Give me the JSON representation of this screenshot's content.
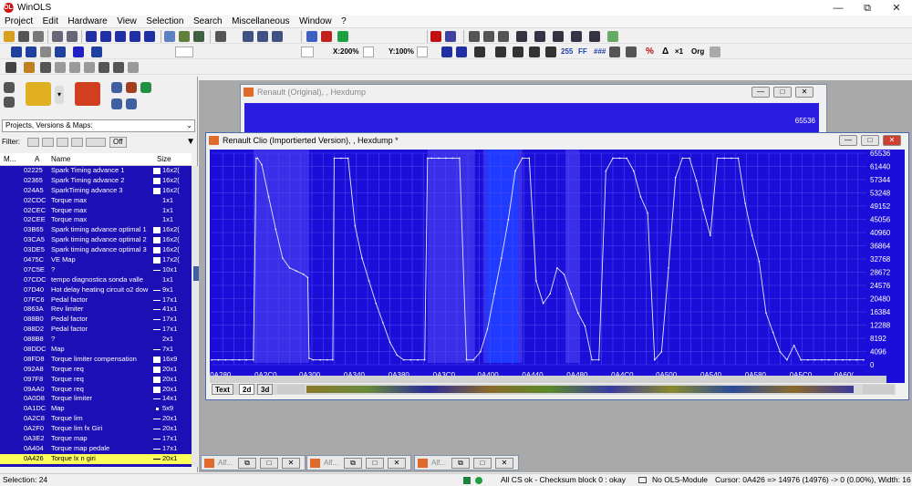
{
  "app": {
    "title": "WinOLS",
    "logo": "OLS",
    "min": "—",
    "max": "⧉",
    "close": "✕"
  },
  "menu": [
    "Project",
    "Edit",
    "Hardware",
    "View",
    "Selection",
    "Search",
    "Miscellaneous",
    "Window",
    "?"
  ],
  "toolbar2": {
    "zoomx": "X:200%",
    "zoomy": "Y:100%",
    "btn_hex": "255",
    "btn_ff": "FF",
    "btn_dec": "###",
    "btn_pct": "%",
    "btn_delta": "Δ",
    "btn_x1": "×1",
    "btn_org": "Org"
  },
  "sidebar": {
    "dropdown_value": "Projects, Versions & Maps:",
    "filter_label": "Filter:",
    "filter_off": "Off",
    "head_m": "M...",
    "head_addr": "A",
    "head_name": "Name",
    "head_size": "Size",
    "rows": [
      {
        "addr": "02225",
        "name": "Spark Timing advance 1",
        "size": "16x2(",
        "marker": "box"
      },
      {
        "addr": "02365",
        "name": "Spark Timing advance  2",
        "size": "16x2(",
        "marker": "box"
      },
      {
        "addr": "024A5",
        "name": "SparkTiming advance 3",
        "size": "16x2(",
        "marker": "box"
      },
      {
        "addr": "02CDC",
        "name": "Torque max",
        "size": "1x1",
        "marker": "none"
      },
      {
        "addr": "02CEC",
        "name": "Torque max",
        "size": "1x1",
        "marker": "none"
      },
      {
        "addr": "02CEE",
        "name": "Torque max",
        "size": "1x1",
        "marker": "none"
      },
      {
        "addr": "03B65",
        "name": "Spark timing advance optimal 1",
        "size": "16x2(",
        "marker": "box"
      },
      {
        "addr": "03CA5",
        "name": "Spark timing advance optimal 2",
        "size": "16x2(",
        "marker": "box"
      },
      {
        "addr": "03DE5",
        "name": "Spark timing advance optimal 3",
        "size": "16x2(",
        "marker": "box"
      },
      {
        "addr": "0475C",
        "name": "VE Map",
        "size": "17x2(",
        "marker": "box"
      },
      {
        "addr": "07C5E",
        "name": "?",
        "size": "10x1",
        "marker": "line"
      },
      {
        "addr": "07CDC",
        "name": "tempo diagnostica sonda valle",
        "size": "1x1",
        "marker": "none"
      },
      {
        "addr": "07D40",
        "name": "Hot delay heating circuit o2 dow",
        "size": "9x1",
        "marker": "line"
      },
      {
        "addr": "07FC6",
        "name": "Pedal factor",
        "size": "17x1",
        "marker": "line"
      },
      {
        "addr": "0863A",
        "name": "Rev limiter",
        "size": "41x1",
        "marker": "line"
      },
      {
        "addr": "088B0",
        "name": "Pedal factor",
        "size": "17x1",
        "marker": "line"
      },
      {
        "addr": "088D2",
        "name": "Pedal factor",
        "size": "17x1",
        "marker": "line"
      },
      {
        "addr": "088B8",
        "name": "?",
        "size": "2x1",
        "marker": "none"
      },
      {
        "addr": "08DDC",
        "name": "Map",
        "size": "7x1",
        "marker": "line"
      },
      {
        "addr": "08FD8",
        "name": "Torque limiter compensation",
        "size": "16x9",
        "marker": "box"
      },
      {
        "addr": "092A8",
        "name": "Torque req",
        "size": "20x1",
        "marker": "box"
      },
      {
        "addr": "097F8",
        "name": "Torque req",
        "size": "20x1",
        "marker": "box"
      },
      {
        "addr": "09AA0",
        "name": "Torque req",
        "size": "20x1",
        "marker": "box"
      },
      {
        "addr": "0A0D8",
        "name": "Torque limiter",
        "size": "14x1",
        "marker": "line"
      },
      {
        "addr": "0A1DC",
        "name": "Map",
        "size": "5x9",
        "marker": "dot"
      },
      {
        "addr": "0A2C8",
        "name": "Torque lim",
        "size": "20x1",
        "marker": "line"
      },
      {
        "addr": "0A2F0",
        "name": "Torque lim fx Giri",
        "size": "20x1",
        "marker": "line"
      },
      {
        "addr": "0A3E2",
        "name": "Torque map",
        "size": "17x1",
        "marker": "line"
      },
      {
        "addr": "0A404",
        "name": "Torque map pedale",
        "size": "17x1",
        "marker": "line"
      },
      {
        "addr": "0A426",
        "name": "Torque lx n giri",
        "size": "20x1",
        "marker": "line",
        "selected": true
      }
    ]
  },
  "back_window": {
    "title": "Renault (Original), , Hexdump",
    "value": "65536"
  },
  "front_window": {
    "title": "Renault Clio (Importierted Version), , Hexdump *",
    "tab_text": "Text",
    "tab_2d": "2d",
    "tab_3d": "3d",
    "y_ticks": [
      "65536",
      "61440",
      "57344",
      "53248",
      "49152",
      "45056",
      "40960",
      "36864",
      "32768",
      "28672",
      "24576",
      "20480",
      "16384",
      "12288",
      "8192",
      "4096",
      "0"
    ],
    "x_ticks": [
      "0A280",
      "0A2C0",
      "0A300",
      "0A340",
      "0A380",
      "0A3C0",
      "0A400",
      "0A440",
      "0A480",
      "0A4C0",
      "0A500",
      "0A540",
      "0A580",
      "0A5C0",
      "0A60("
    ]
  },
  "chart_data": {
    "type": "line",
    "xlabel": "",
    "ylabel": "",
    "ylim": [
      0,
      65536
    ],
    "x_range": [
      "0A270",
      "0A61C"
    ],
    "series": [
      {
        "x": [
          "0A270",
          "0A27A",
          "0A284",
          "0A28E",
          "0A298",
          "0A2A2",
          "0A2AC",
          "0A2B0",
          "0A2B2",
          "0A2B8",
          "0A2C2",
          "0A2CC",
          "0A2D6",
          "0A2E0",
          "0A2EA",
          "0A2F4",
          "0A2FA",
          "0A2FC",
          "0A302",
          "0A30C",
          "0A316",
          "0A31E",
          "0A320",
          "0A32A",
          "0A334",
          "0A33E",
          "0A348",
          "0A352",
          "0A35C",
          "0A366",
          "0A370",
          "0A37A",
          "0A384",
          "0A38E",
          "0A398",
          "0A3A2",
          "0A3A6",
          "0A3AC",
          "0A3B6",
          "0A3C0",
          "0A3CA",
          "0A3D4",
          "0A3DE",
          "0A3E8",
          "0A3F2",
          "0A3FC",
          "0A406",
          "0A410",
          "0A41A",
          "0A424",
          "0A42E",
          "0A438",
          "0A442",
          "0A44C",
          "0A456",
          "0A460",
          "0A46A",
          "0A474",
          "0A47E",
          "0A488",
          "0A492",
          "0A49C",
          "0A4A6",
          "0A4B0",
          "0A4BA",
          "0A4C4",
          "0A4CE",
          "0A4D8",
          "0A4E2",
          "0A4EC",
          "0A4F6",
          "0A500",
          "0A50A",
          "0A514",
          "0A51E",
          "0A528",
          "0A532",
          "0A53C",
          "0A546",
          "0A550",
          "0A55A",
          "0A564",
          "0A56E",
          "0A578",
          "0A582",
          "0A58C",
          "0A596",
          "0A5A0",
          "0A5AA",
          "0A5B4",
          "0A5BE",
          "0A5C8",
          "0A5D2",
          "0A5DC",
          "0A5E6",
          "0A5F0",
          "0A5FA",
          "0A604",
          "0A60E",
          "0A618"
        ],
        "values": [
          1500,
          1500,
          1500,
          1500,
          1500,
          1500,
          1500,
          64000,
          64000,
          62000,
          52000,
          42000,
          33000,
          30000,
          29000,
          28000,
          27000,
          2000,
          1500,
          1500,
          1500,
          1500,
          64000,
          64000,
          64000,
          43000,
          33000,
          26000,
          19000,
          13000,
          7000,
          3000,
          1500,
          1500,
          1500,
          1500,
          64000,
          64000,
          64000,
          64000,
          64000,
          64000,
          1500,
          1500,
          4000,
          11000,
          22000,
          33000,
          45000,
          60000,
          64000,
          64000,
          26000,
          19000,
          22000,
          30000,
          28000,
          22000,
          16000,
          12000,
          1500,
          1500,
          60000,
          64000,
          64000,
          64000,
          60000,
          52000,
          47000,
          1500,
          4000,
          30000,
          58000,
          64000,
          64000,
          57000,
          48000,
          40000,
          64000,
          64000,
          64000,
          64000,
          50000,
          40000,
          32000,
          16000,
          10000,
          4000,
          1500,
          6000,
          1500,
          1500,
          1500,
          1500,
          1500,
          1500,
          1500,
          1500,
          1500,
          1500
        ]
      }
    ]
  },
  "mini_windows": [
    {
      "label": "Alf...",
      "restore": "⧉",
      "max": "□",
      "close": "✕"
    },
    {
      "label": "Alf...",
      "restore": "⧉",
      "max": "□",
      "close": "✕"
    },
    {
      "label": "Alf...",
      "restore": "⧉",
      "max": "□",
      "close": "✕"
    }
  ],
  "status": {
    "selection": "Selection: 24",
    "checksum": "All CS ok - Checksum block 0 : okay",
    "module": "No OLS-Module",
    "cursor": "Cursor: 0A426 => 14976 (14976) -> 0 (0.00%), Width: 16"
  },
  "colors": {
    "plot_bg": "#1a0ed8",
    "list_bg": "#1c0fb6",
    "selection": "#ffff5a",
    "highlight": "#3a2cff"
  }
}
